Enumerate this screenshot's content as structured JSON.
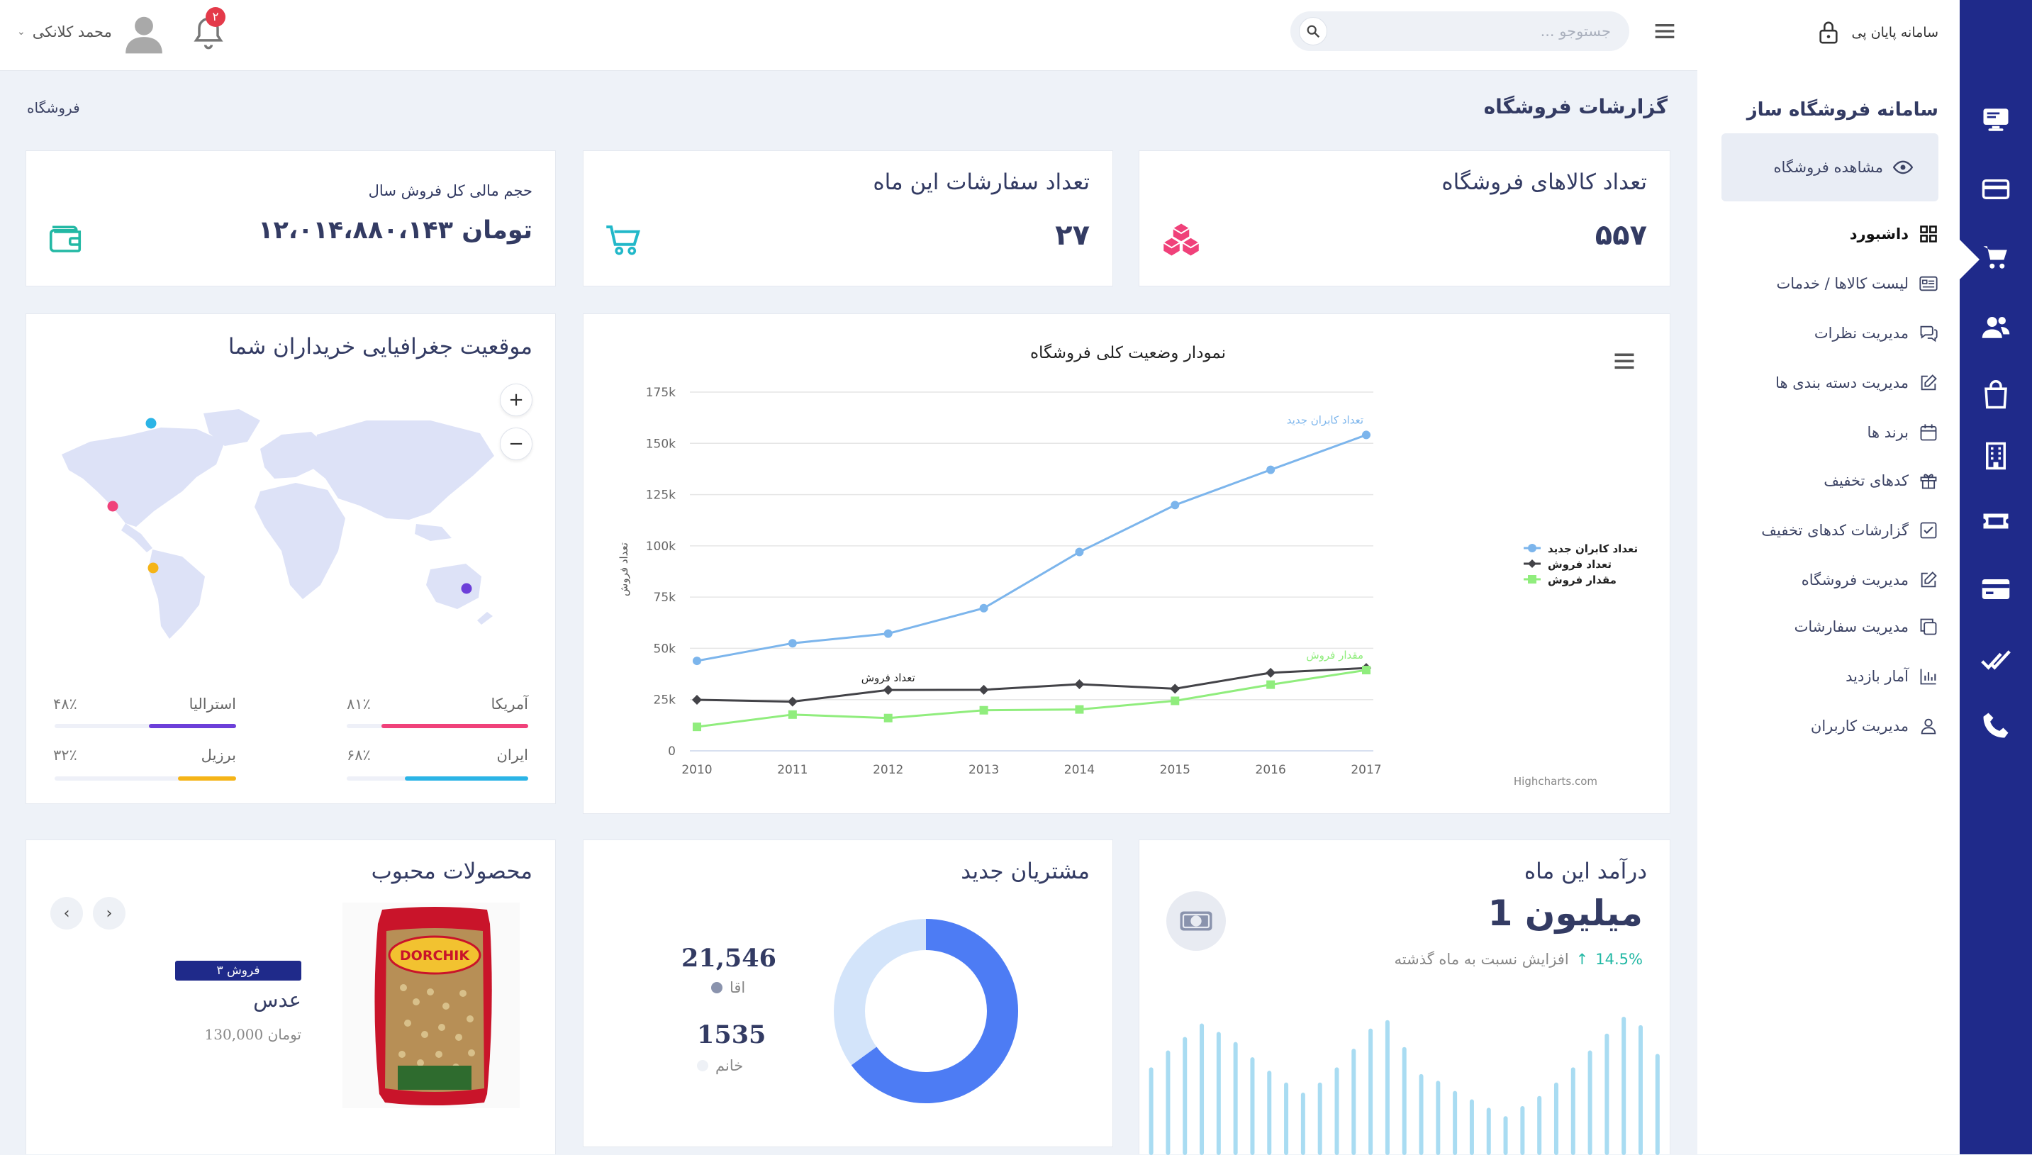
{
  "brand": {
    "name": "سامانه پایان پی"
  },
  "topbar": {
    "search_placeholder": "جستوجو ...",
    "notification_count": "۲",
    "user_name": "محمد کلانکی"
  },
  "menu": {
    "title": "سامانه فروشگاه ساز",
    "view_shop": "مشاهده فروشگاه",
    "items": [
      {
        "label": "داشبورد",
        "icon": "dashboard-icon"
      },
      {
        "label": "لیست کالاها / خدمات",
        "icon": "list-icon"
      },
      {
        "label": "مدیریت نظرات",
        "icon": "comments-icon"
      },
      {
        "label": "مدیریت دسته بندی ها",
        "icon": "edit-icon"
      },
      {
        "label": "برند ها",
        "icon": "calendar-icon"
      },
      {
        "label": "کدهای تخفیف",
        "icon": "gift-icon"
      },
      {
        "label": "گزارشات کدهای تخفیف",
        "icon": "checkbox-icon"
      },
      {
        "label": "مدیریت فروشگاه",
        "icon": "edit-icon"
      },
      {
        "label": "مدیریت سفارشات",
        "icon": "copy-icon"
      },
      {
        "label": "آمار بازدید",
        "icon": "bar-chart-icon"
      },
      {
        "label": "مدیریت کاربران",
        "icon": "user-icon"
      }
    ]
  },
  "rail_icons": [
    "monitor-icon",
    "credit-card-icon",
    "cart-icon",
    "users-icon",
    "shopping-bag-icon",
    "building-icon",
    "ticket-icon",
    "card-icon",
    "double-check-icon",
    "phone-icon"
  ],
  "page": {
    "title": "گزارشات فروشگاه",
    "breadcrumb": "فروشگاه"
  },
  "stats": {
    "products": {
      "title": "تعداد کالاهای فروشگاه",
      "value": "۵۵۷"
    },
    "orders": {
      "title": "تعداد سفارشات این ماه",
      "value": "۲۷"
    },
    "sales": {
      "title": "حجم مالی کل فروش سال",
      "value": "۱۲،۰۱۴،۸۸۰،۱۴۳ تومان"
    }
  },
  "main_chart": {
    "title": "نمودار وضعیت کلی فروشگاه",
    "credit": "Highcharts.com",
    "ylabel": "تعداد فروش"
  },
  "chart_data": {
    "type": "line",
    "title": "نمودار وضعیت کلی فروشگاه",
    "xlabel": "",
    "ylabel": "تعداد فروش",
    "x": [
      2010,
      2011,
      2012,
      2013,
      2014,
      2015,
      2016,
      2017
    ],
    "ylim": [
      0,
      175000
    ],
    "yticks": [
      "0",
      "25k",
      "50k",
      "75k",
      "100k",
      "125k",
      "150k",
      "175k"
    ],
    "grid": true,
    "legend": "right",
    "series": [
      {
        "name": "تعداد کابران جدید",
        "color": "#7cb5ec",
        "marker": "circle",
        "values": [
          43900,
          52500,
          57200,
          69600,
          97000,
          119900,
          137100,
          154100
        ]
      },
      {
        "name": "تعداد فروش",
        "color": "#434348",
        "marker": "diamond",
        "values": [
          24900,
          24000,
          29700,
          29800,
          32500,
          30300,
          38100,
          40400
        ]
      },
      {
        "name": "مقدار فروش",
        "color": "#90ed7d",
        "marker": "square",
        "values": [
          11700,
          17700,
          16000,
          19800,
          20200,
          24400,
          32300,
          39400
        ]
      }
    ]
  },
  "geo": {
    "title": "موقعیت جغرافیایی خریداران شما",
    "zoom_in": "+",
    "zoom_out": "−",
    "countries": [
      {
        "name": "آمریکا",
        "pct": "۸۱٪",
        "value": 81,
        "color": "#f0417a"
      },
      {
        "name": "استرالیا",
        "pct": "۴۸٪",
        "value": 48,
        "color": "#6c3fd9"
      },
      {
        "name": "ایران",
        "pct": "۶۸٪",
        "value": 68,
        "color": "#2bb4e6"
      },
      {
        "name": "برزیل",
        "pct": "۳۲٪",
        "value": 32,
        "color": "#f5b417"
      }
    ]
  },
  "revenue": {
    "title": "درآمد این ماه",
    "value": "1 میلیون",
    "change": "14.5%",
    "change_text": "افزایش نسبت به ماه گذشته",
    "bars": [
      52,
      62,
      70,
      78,
      73,
      67,
      58,
      50,
      43,
      37,
      43,
      52,
      63,
      75,
      80,
      64,
      48,
      44,
      38,
      33,
      28,
      23,
      29,
      35,
      43,
      52,
      62,
      72,
      82,
      77,
      60
    ]
  },
  "customers": {
    "title": "مشتریان جدید",
    "male_value": "21,546",
    "male_label": "اقا",
    "female_value": "1535",
    "female_label": "خانم",
    "male_color": "#4d7cf4",
    "female_color": "#d3e4fa"
  },
  "products_card": {
    "title": "محصولات محبوب",
    "badge": "۳ فروش",
    "name": "عدس",
    "price": "130,000 تومان",
    "package_brand": "DORCHIK",
    "prev": "‹",
    "next": "›"
  }
}
